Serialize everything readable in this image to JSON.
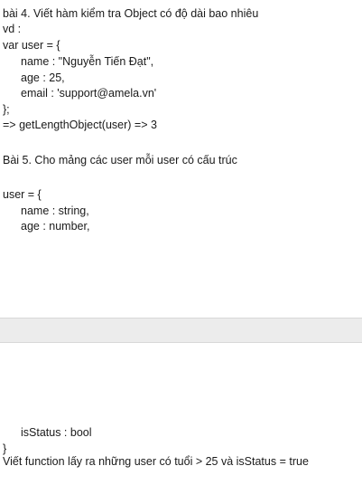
{
  "page1": {
    "lines": [
      "bài 4. Viết hàm kiểm tra Object có độ dài bao nhiêu",
      "vd :",
      "var user = {",
      "name : \"Nguyễn Tiến Đạt\",",
      "age : 25,",
      "email : 'support@amela.vn'",
      "};",
      "=> getLengthObject(user) => 3",
      "Bài 5. Cho mảng các user mỗi user có cấu trúc",
      "user = {",
      "name : string,",
      "age : number,"
    ]
  },
  "page2": {
    "lines": [
      "isStatus : bool",
      "}",
      "Viết function lấy ra những user có tuổi > 25 và isStatus = true"
    ]
  }
}
